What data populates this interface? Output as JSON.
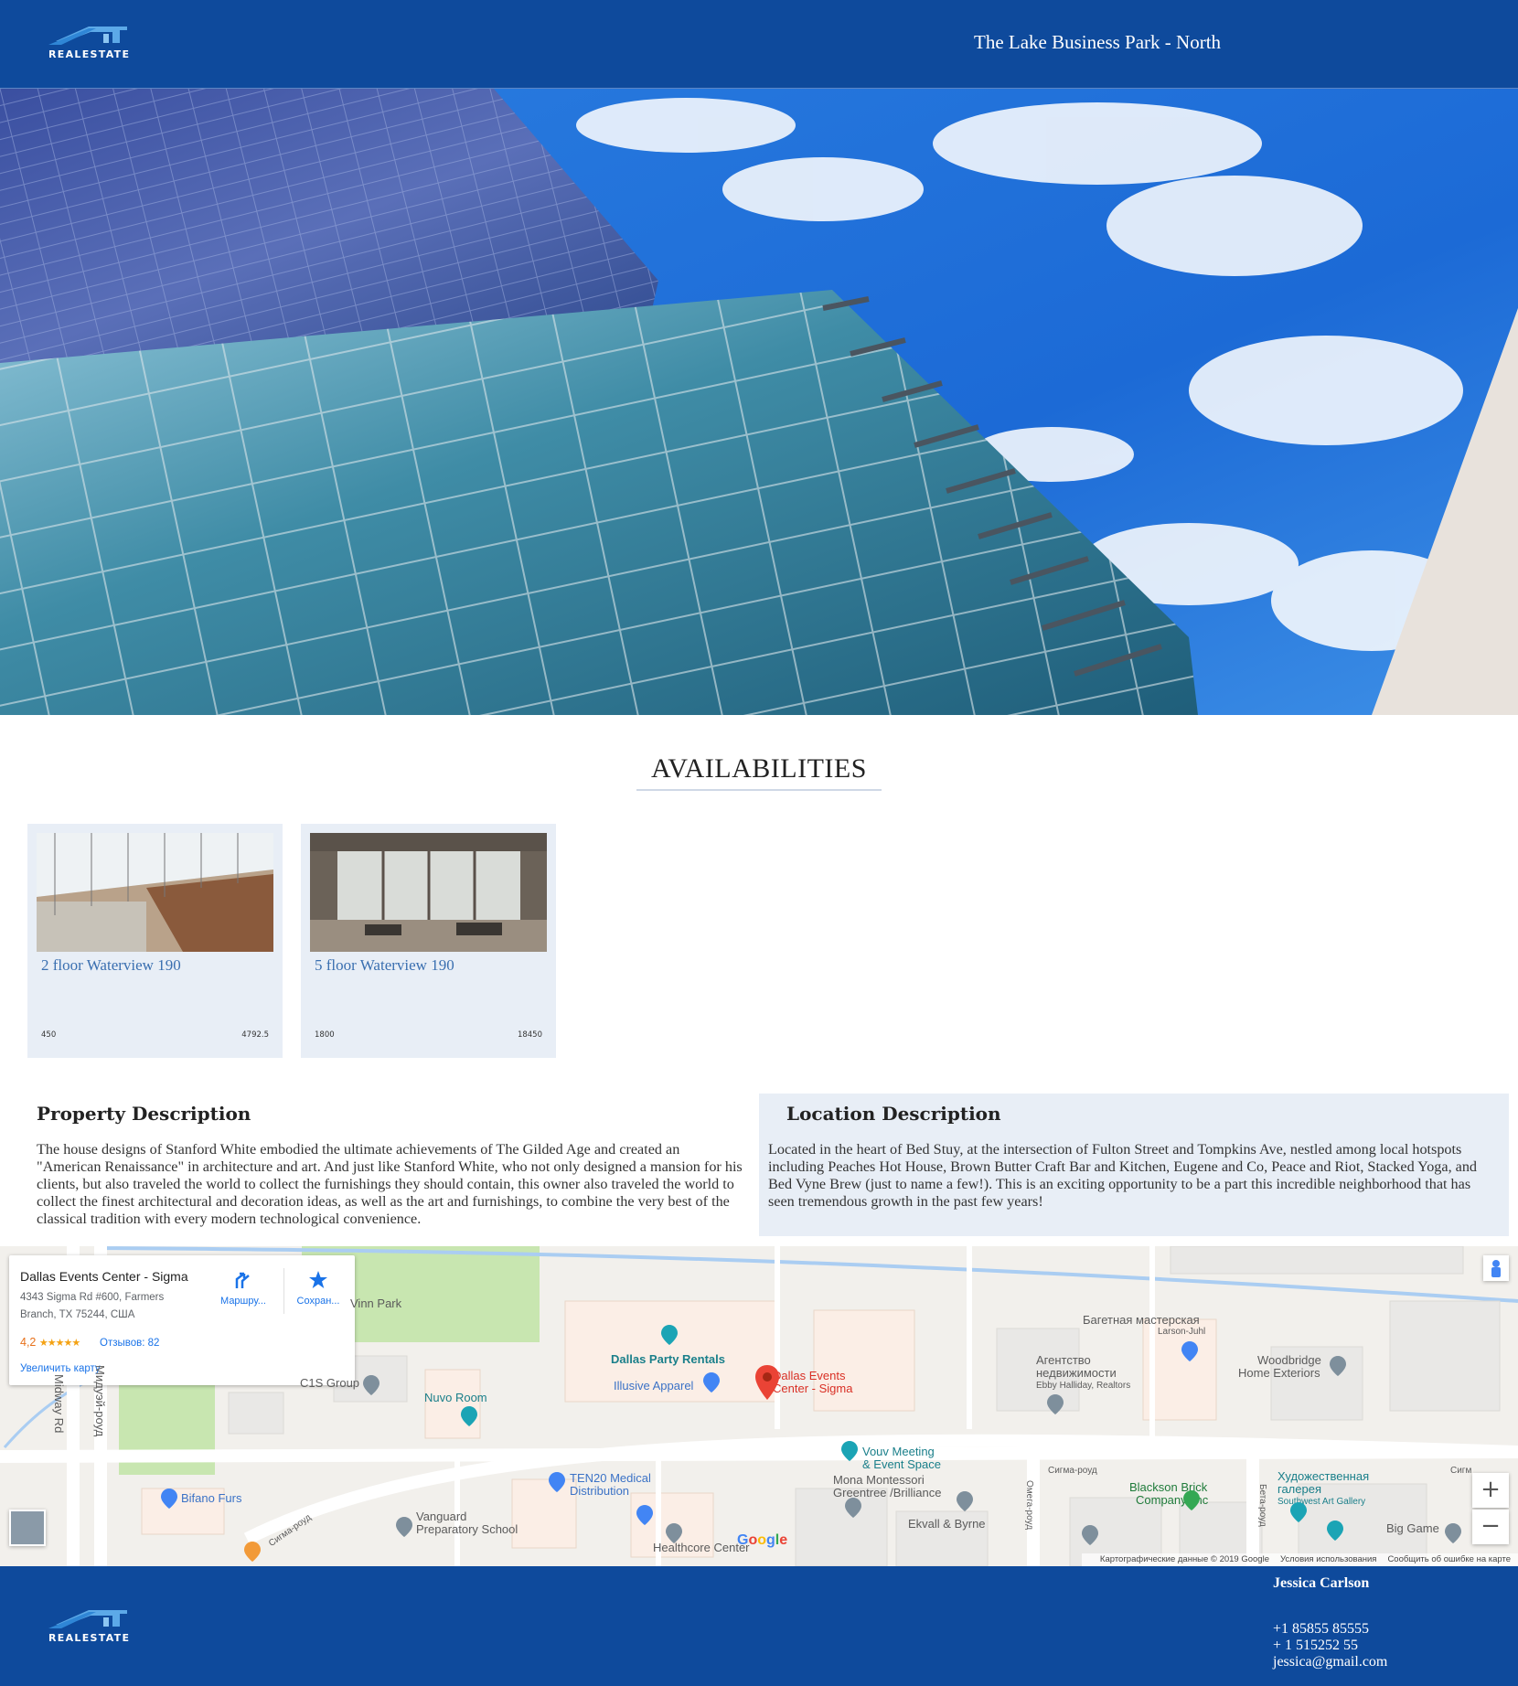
{
  "brand": {
    "logo_text": "REALESTATE",
    "color": "#0e4a9c"
  },
  "header": {
    "title": "The Lake Business Park - North"
  },
  "availabilities": {
    "heading": "AVAILABILITIES",
    "cards": [
      {
        "title": "2 floor Waterview 190",
        "left_value": "450",
        "right_value": "4792.5"
      },
      {
        "title": "5 floor Waterview 190",
        "left_value": "1800",
        "right_value": "18450"
      }
    ]
  },
  "property": {
    "heading": "Property Description",
    "text": "The house designs of Stanford White embodied the ultimate achievements of The Gilded Age and created an \"American Renaissance\" in architecture and art. And just like Stanford White, who not only designed a mansion for his clients, but also traveled the world to collect the furnishings they should contain, this owner also traveled the world to collect the finest architectural and decoration ideas, as well as the art and furnishings, to combine the very best of the classical tradition with every modern technological convenience."
  },
  "location": {
    "heading": "Location Description",
    "text": "Located in the heart of Bed Stuy, at the intersection of Fulton Street and Tompkins Ave, nestled among local hotspots including Peaches Hot House, Brown Butter Craft Bar and Kitchen, Eugene and Co, Peace and Riot, Stacked Yoga, and Bed Vyne Brew (just to name a few!). This is an exciting opportunity to be a part this incredible neighborhood that has seen tremendous growth in the past few years!"
  },
  "map": {
    "info": {
      "name": "Dallas Events Center - Sigma",
      "address": "4343 Sigma Rd #600, Farmers Branch, TX 75244, США",
      "rating": "4,2",
      "stars": "★★★★★",
      "reviews": "Отзывов: 82",
      "enlarge": "Увеличить карту",
      "directions": "Маршру...",
      "save": "Сохран..."
    },
    "labels": {
      "park": "Vinn Park",
      "c1s": "C1S Group",
      "nuvo": "Nuvo Room",
      "party": "Dallas Party Rentals",
      "apparel": "Illusive Apparel",
      "center": "Dallas Events Center - Sigma",
      "baguette": "Багетная мастерская",
      "larson": "Larson-Juhl",
      "agency1": "Агентство",
      "agency2": "недвижимости",
      "ebby": "Ebby Halliday, Realtors",
      "woodbridge1": "Woodbridge",
      "woodbridge2": "Home Exteriors",
      "vouv1": "Vouv Meeting",
      "vouv2": "& Event Space",
      "sigma_road": "Сигма-роуд",
      "sigma_road2": "Сигм",
      "ten20_1": "TEN20 Medical",
      "ten20_2": "Distribution",
      "mona1": "Mona Montessori",
      "mona2": "Greentree /Brilliance",
      "blackson1": "Blackson Brick",
      "blackson2": "Company, Inc",
      "art1": "Художественная",
      "art2": "галерея",
      "art3": "Southwest Art Gallery",
      "bifano": "Bifano Furs",
      "vanguard1": "Vanguard",
      "vanguard2": "Preparatory School",
      "ekvall": "Ekvall & Byrne",
      "healthcore": "Healthcore Center",
      "big_game": "Big Game",
      "midway": "Midway Rd",
      "midway_ru": "Мидуэй-роуд",
      "omega": "Омега-роуд",
      "beta": "Бета-роуд",
      "sigma_diag": "Сигма-роуд"
    },
    "google": "Google",
    "footer_data": "Картографические данные © 2019 Google",
    "footer_terms": "Условия использования",
    "footer_report": "Сообщить об ошибке на карте",
    "zoom_in": "+",
    "zoom_out": "−"
  },
  "footer": {
    "name": "Jessica Carlson",
    "phone1": "+1 85855 85555",
    "phone2": "+ 1 515252 55",
    "email": "jessica@gmail.com"
  }
}
